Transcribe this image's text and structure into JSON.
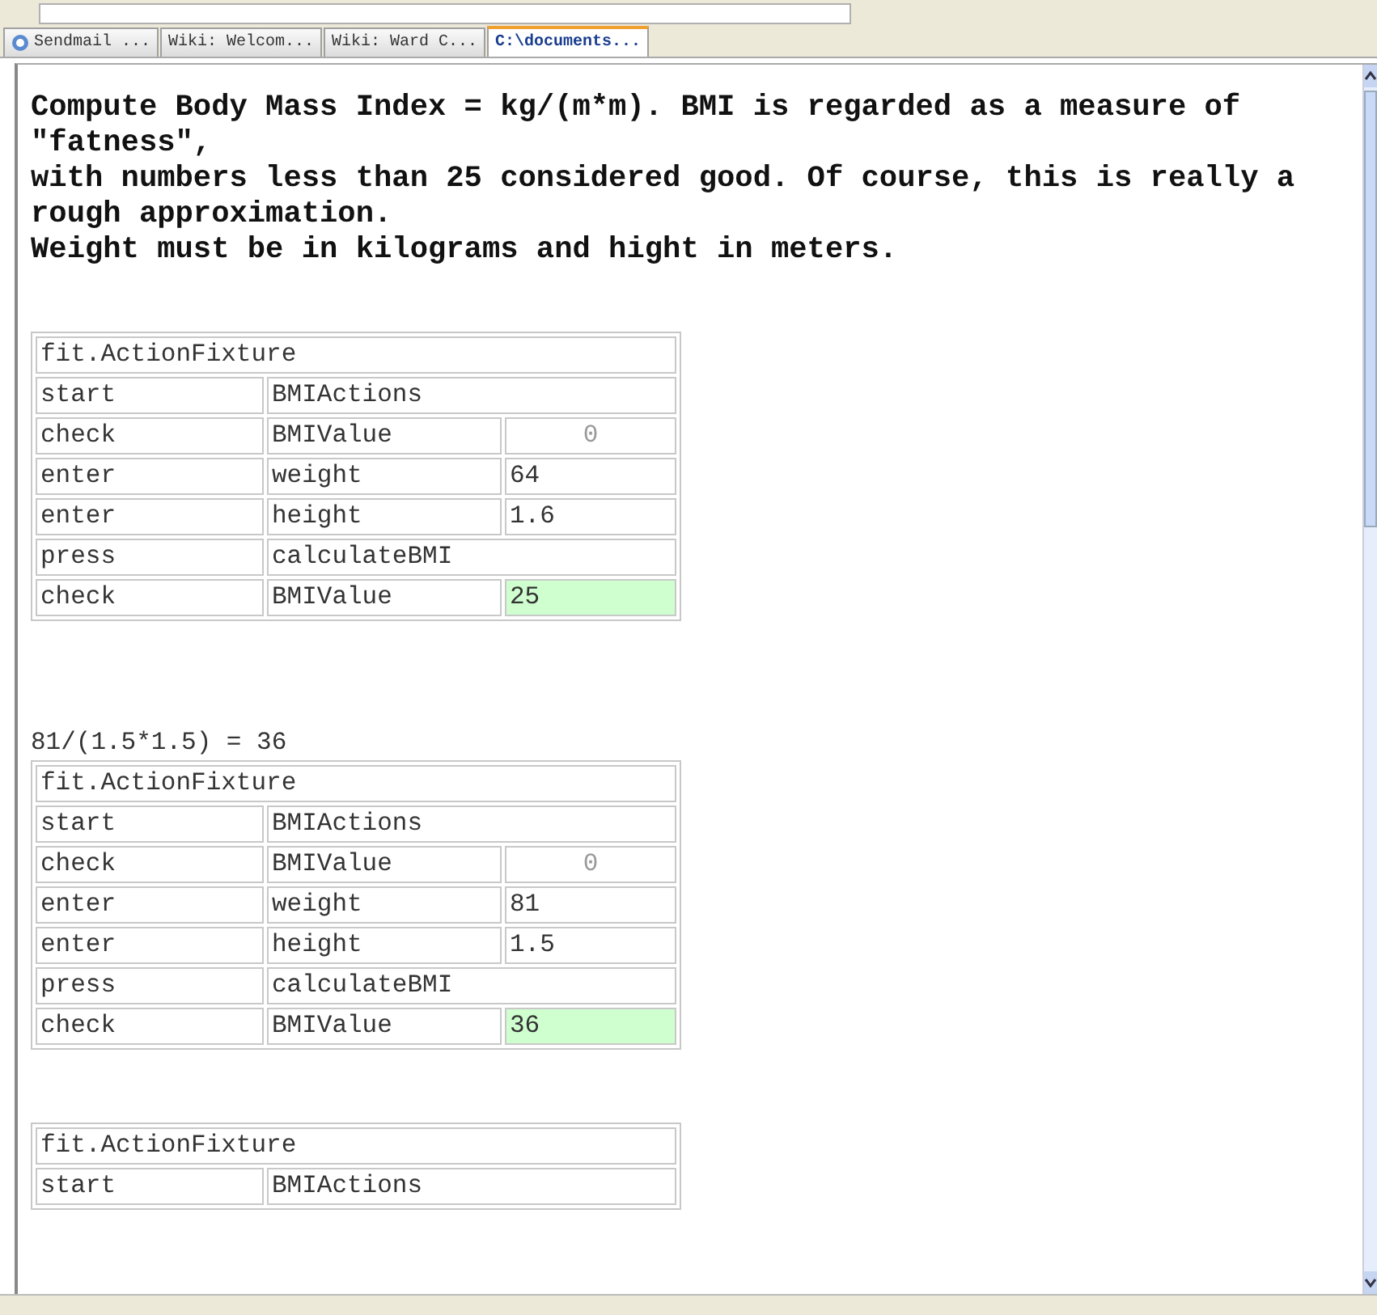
{
  "tabs": [
    {
      "label": "Sendmail ...",
      "selected": false
    },
    {
      "label": "Wiki: Welcom...",
      "selected": false
    },
    {
      "label": "Wiki: Ward C...",
      "selected": false
    },
    {
      "label": "C:\\documents...",
      "selected": true
    }
  ],
  "intro": [
    "Compute Body Mass Index = kg/(m*m). BMI is regarded as a measure of \"fatness\",",
    "with numbers less than 25 considered good. Of course, this is really a rough approximation.",
    "Weight must be in kilograms and hight in meters."
  ],
  "tables": [
    {
      "rows": [
        {
          "cells": [
            {
              "text": "fit.ActionFixture",
              "colspan": 3,
              "passed": false,
              "greyed": false
            }
          ]
        },
        {
          "cells": [
            {
              "text": "start",
              "passed": false,
              "greyed": false
            },
            {
              "text": "BMIActions",
              "colspan": 2,
              "passed": false,
              "greyed": false
            }
          ]
        },
        {
          "cells": [
            {
              "text": "check",
              "passed": false,
              "greyed": false
            },
            {
              "text": "BMIValue",
              "passed": false,
              "greyed": false
            },
            {
              "text": "0",
              "passed": false,
              "greyed": true
            }
          ]
        },
        {
          "cells": [
            {
              "text": "enter",
              "passed": false,
              "greyed": false
            },
            {
              "text": "weight",
              "passed": false,
              "greyed": false
            },
            {
              "text": "64",
              "passed": false,
              "greyed": false
            }
          ]
        },
        {
          "cells": [
            {
              "text": "enter",
              "passed": false,
              "greyed": false
            },
            {
              "text": "height",
              "passed": false,
              "greyed": false
            },
            {
              "text": "1.6",
              "passed": false,
              "greyed": false
            }
          ]
        },
        {
          "cells": [
            {
              "text": "press",
              "passed": false,
              "greyed": false
            },
            {
              "text": "calculateBMI",
              "colspan": 2,
              "passed": false,
              "greyed": false
            }
          ]
        },
        {
          "cells": [
            {
              "text": "check",
              "passed": false,
              "greyed": false
            },
            {
              "text": "BMIValue",
              "passed": false,
              "greyed": false
            },
            {
              "text": "25",
              "passed": true,
              "greyed": false
            }
          ]
        }
      ]
    },
    {
      "caption": "81/(1.5*1.5) = 36",
      "rows": [
        {
          "cells": [
            {
              "text": "fit.ActionFixture",
              "colspan": 3,
              "passed": false,
              "greyed": false
            }
          ]
        },
        {
          "cells": [
            {
              "text": "start",
              "passed": false,
              "greyed": false
            },
            {
              "text": "BMIActions",
              "colspan": 2,
              "passed": false,
              "greyed": false
            }
          ]
        },
        {
          "cells": [
            {
              "text": "check",
              "passed": false,
              "greyed": false
            },
            {
              "text": "BMIValue",
              "passed": false,
              "greyed": false
            },
            {
              "text": "0",
              "passed": false,
              "greyed": true
            }
          ]
        },
        {
          "cells": [
            {
              "text": "enter",
              "passed": false,
              "greyed": false
            },
            {
              "text": "weight",
              "passed": false,
              "greyed": false
            },
            {
              "text": "81",
              "passed": false,
              "greyed": false
            }
          ]
        },
        {
          "cells": [
            {
              "text": "enter",
              "passed": false,
              "greyed": false
            },
            {
              "text": "height",
              "passed": false,
              "greyed": false
            },
            {
              "text": "1.5",
              "passed": false,
              "greyed": false
            }
          ]
        },
        {
          "cells": [
            {
              "text": "press",
              "passed": false,
              "greyed": false
            },
            {
              "text": "calculateBMI",
              "colspan": 2,
              "passed": false,
              "greyed": false
            }
          ]
        },
        {
          "cells": [
            {
              "text": "check",
              "passed": false,
              "greyed": false
            },
            {
              "text": "BMIValue",
              "passed": false,
              "greyed": false
            },
            {
              "text": "36",
              "passed": true,
              "greyed": false
            }
          ]
        }
      ]
    },
    {
      "rows": [
        {
          "cells": [
            {
              "text": "fit.ActionFixture",
              "colspan": 3,
              "passed": false,
              "greyed": false
            }
          ]
        },
        {
          "cells": [
            {
              "text": "start",
              "passed": false,
              "greyed": false
            },
            {
              "text": "BMIActions",
              "colspan": 2,
              "passed": false,
              "greyed": false
            }
          ]
        }
      ]
    }
  ]
}
